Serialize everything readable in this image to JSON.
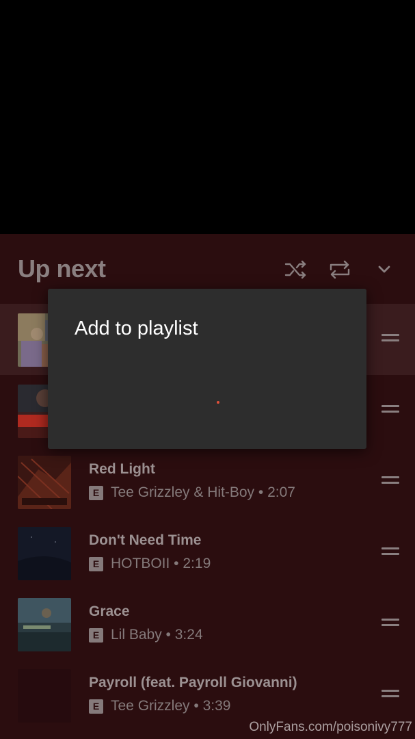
{
  "queue": {
    "title": "Up next",
    "controls": [
      {
        "name": "shuffle-icon"
      },
      {
        "name": "repeat-icon"
      },
      {
        "name": "chevron-down-icon"
      }
    ],
    "explicit_label": "E",
    "tracks": [
      {
        "title": "",
        "artist": "",
        "duration": "",
        "explicit": false,
        "active": true
      },
      {
        "title": "",
        "artist": "",
        "duration": "",
        "explicit": false,
        "active": false
      },
      {
        "title": "Red Light",
        "artist": "Tee Grizzley & Hit-Boy",
        "duration": "2:07",
        "explicit": true
      },
      {
        "title": "Don't Need Time",
        "artist": "HOTBOII",
        "duration": "2:19",
        "explicit": true
      },
      {
        "title": "Grace",
        "artist": "Lil Baby",
        "duration": "3:24",
        "explicit": true
      },
      {
        "title": "Payroll (feat. Payroll Giovanni)",
        "artist": "Tee Grizzley",
        "duration": "3:39",
        "explicit": true
      }
    ]
  },
  "dialog": {
    "title": "Add to playlist"
  },
  "watermark": "OnlyFans.com/poisonivy777",
  "colors": {
    "panel_bg": "#2b0d0f",
    "active_row_bg": "#3a1c1e",
    "dialog_bg": "#2d2d2d",
    "spinner": "#e0503a"
  }
}
